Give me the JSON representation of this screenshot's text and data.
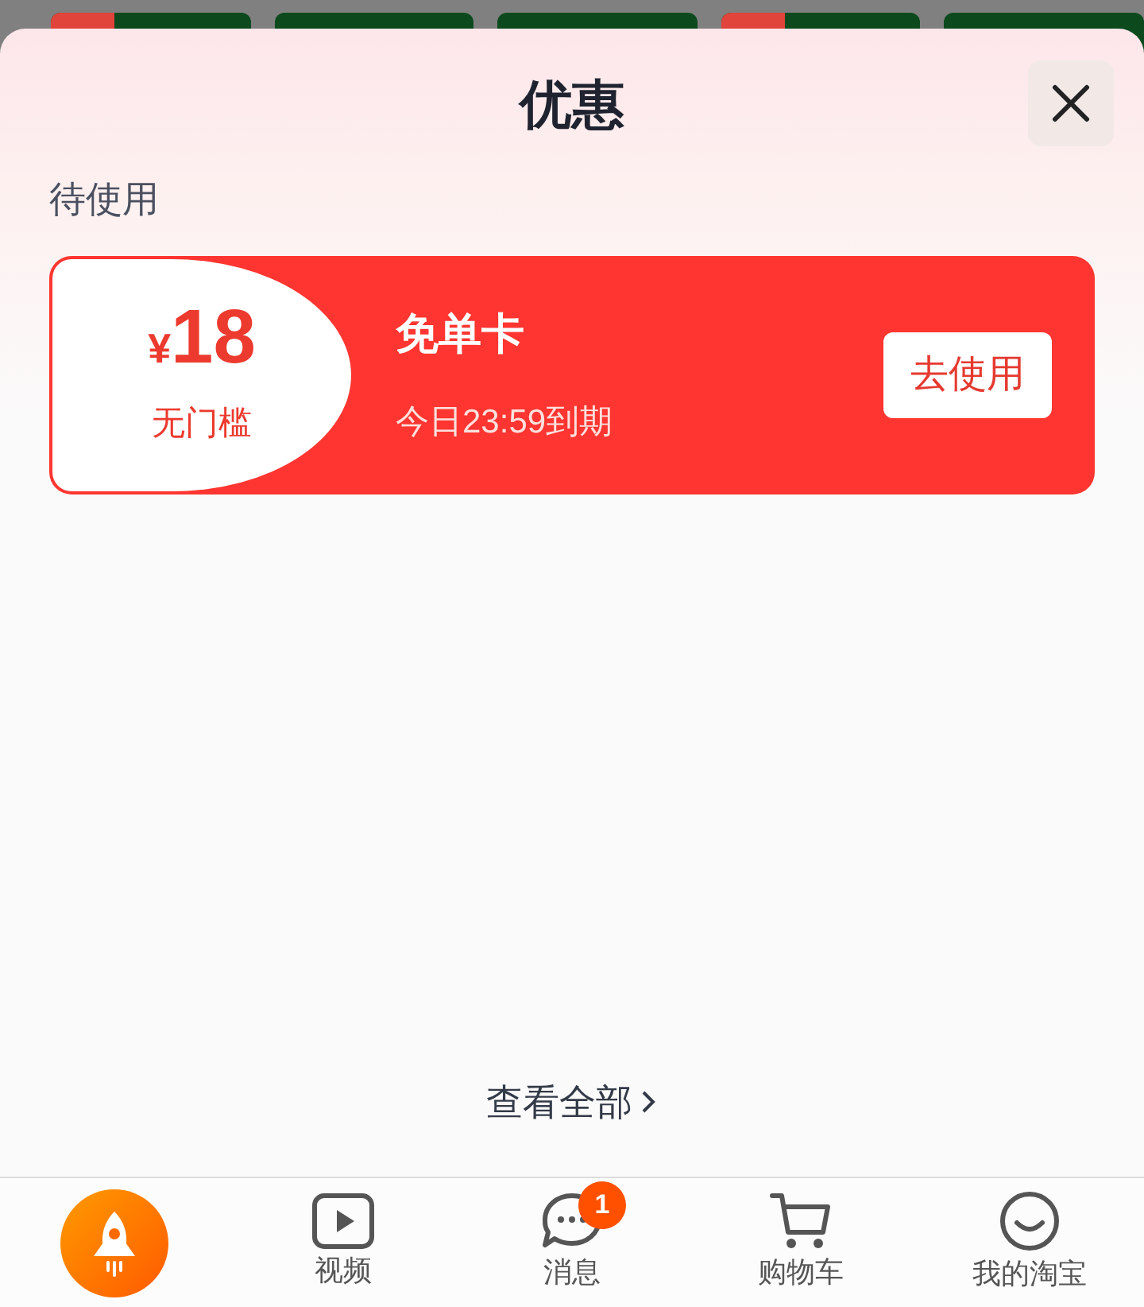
{
  "sheet": {
    "title": "优惠",
    "section_label": "待使用",
    "view_all": "查看全部"
  },
  "coupons": [
    {
      "amount": "18",
      "currency": "¥",
      "condition": "无门槛",
      "name": "免单卡",
      "expiry": "今日23:59到期",
      "action": "去使用"
    }
  ],
  "nav_items": [
    {
      "kind": "home",
      "selected": true
    },
    {
      "kind": "video",
      "label": "视频",
      "selected": false
    },
    {
      "kind": "message",
      "label": "消息",
      "badge": "1",
      "selected": false
    },
    {
      "kind": "cart",
      "label": "购物车",
      "selected": false
    },
    {
      "kind": "profile",
      "label": "我的淘宝",
      "selected": false
    }
  ]
}
